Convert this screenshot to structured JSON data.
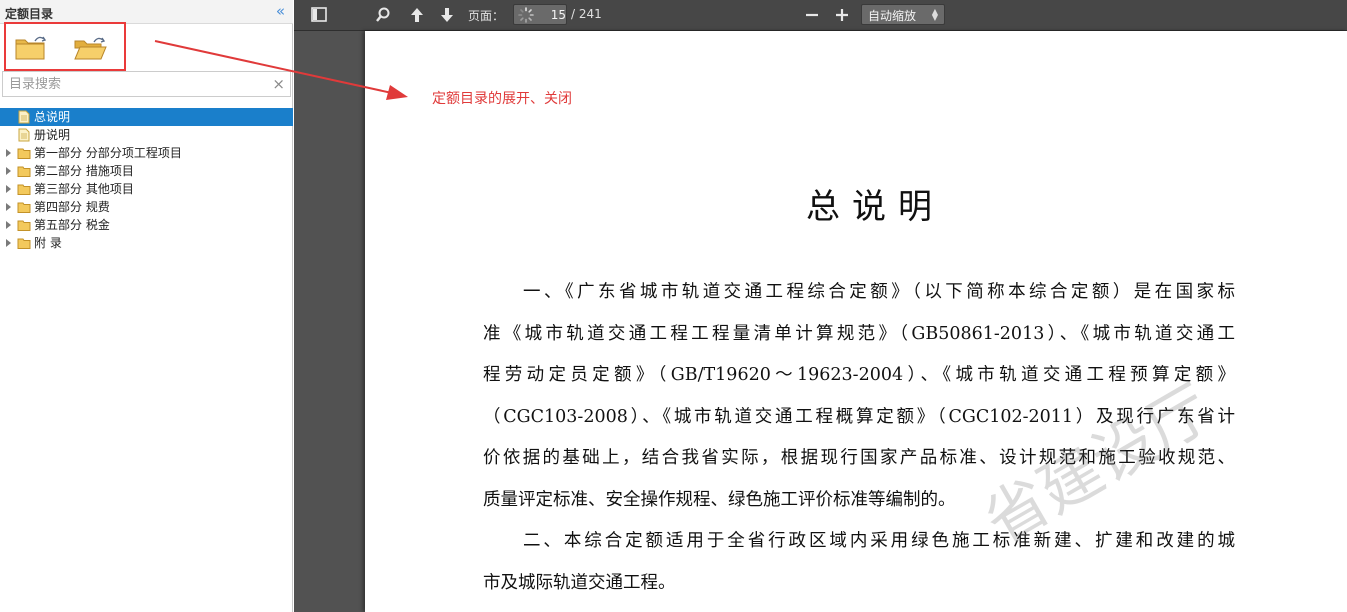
{
  "sidebar": {
    "title": "定额目录",
    "collapse_glyph": "«",
    "search": {
      "placeholder": "目录搜索",
      "value": "",
      "clear_glyph": "×"
    },
    "tree": [
      {
        "label": "总说明",
        "type": "doc",
        "selected": true
      },
      {
        "label": "册说明",
        "type": "doc",
        "selected": false
      },
      {
        "label": "第一部分 分部分项工程项目",
        "type": "folder",
        "selected": false
      },
      {
        "label": "第二部分 措施项目",
        "type": "folder",
        "selected": false
      },
      {
        "label": "第三部分 其他项目",
        "type": "folder",
        "selected": false
      },
      {
        "label": "第四部分 规费",
        "type": "folder",
        "selected": false
      },
      {
        "label": "第五部分 税金",
        "type": "folder",
        "selected": false
      },
      {
        "label": "附 录",
        "type": "folder",
        "selected": false
      }
    ]
  },
  "viewer": {
    "page_label": "页面：",
    "current_page": "15",
    "total_pages": "/ 241",
    "zoom": "自动缩放"
  },
  "annotation": {
    "text": "定额目录的展开、关闭"
  },
  "document": {
    "title": "总说明",
    "paragraphs": [
      [
        "一、《广东省城市轨道交通工程综合定额》（以下简称本综合定额）是在国家标",
        "准《城市轨道交通工程工程量清单计算规范》（GB50861-2013）、《城市轨道交通工",
        "程劳动定员定额》（GB/T19620～19623-2004）、《城市轨道交通工程预算定额》",
        "（CGC103-2008）、《城市轨道交通工程概算定额》（CGC102-2011）及现行广东省计",
        "价依据的基础上，结合我省实际，根据现行国家产品标准、设计规范和施工验收规范、",
        "质量评定标准、安全操作规程、绿色施工评价标准等编制的。"
      ],
      [
        "二、本综合定额适用于全省行政区域内采用绿色施工标准新建、扩建和改建的城",
        "市及城际轨道交通工程。"
      ]
    ],
    "watermark": "省建设厅"
  },
  "colors": {
    "accent": "#1a7fcb",
    "annotation": "#e03a3a",
    "toolbar": "#474747",
    "viewer_bg": "#525252"
  }
}
